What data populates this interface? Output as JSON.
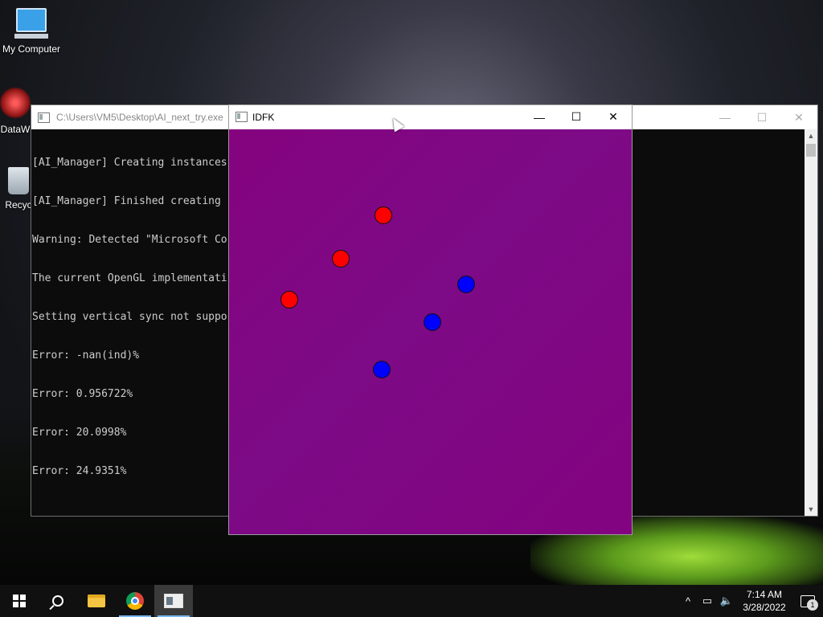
{
  "desktop": {
    "icons": [
      {
        "label": "My Computer"
      },
      {
        "label": "DataW"
      },
      {
        "label": "Recyc"
      }
    ]
  },
  "console_window": {
    "title": "C:\\Users\\VM5\\Desktop\\AI_next_try.exe",
    "lines": [
      "[AI_Manager] Creating instances",
      "[AI_Manager] Finished creating",
      "Warning: Detected \"Microsoft Co",
      "The current OpenGL implementati",
      "Setting vertical sync not suppo",
      "Error: -nan(ind)%",
      "Error: 0.956722%",
      "Error: 20.0998%",
      "Error: 24.9351%"
    ],
    "controls": {
      "minimize": "—",
      "maximize": "☐",
      "close": "✕"
    }
  },
  "idfk_window": {
    "title": "IDFK",
    "controls": {
      "minimize": "—",
      "maximize": "☐",
      "close": "✕"
    },
    "background_color": "#800080",
    "points": [
      {
        "color": "red"
      },
      {
        "color": "red"
      },
      {
        "color": "red"
      },
      {
        "color": "blue"
      },
      {
        "color": "blue"
      },
      {
        "color": "blue"
      }
    ]
  },
  "taskbar": {
    "tray": {
      "time": "7:14 AM",
      "date": "3/28/2022",
      "notification_count": "1"
    }
  }
}
